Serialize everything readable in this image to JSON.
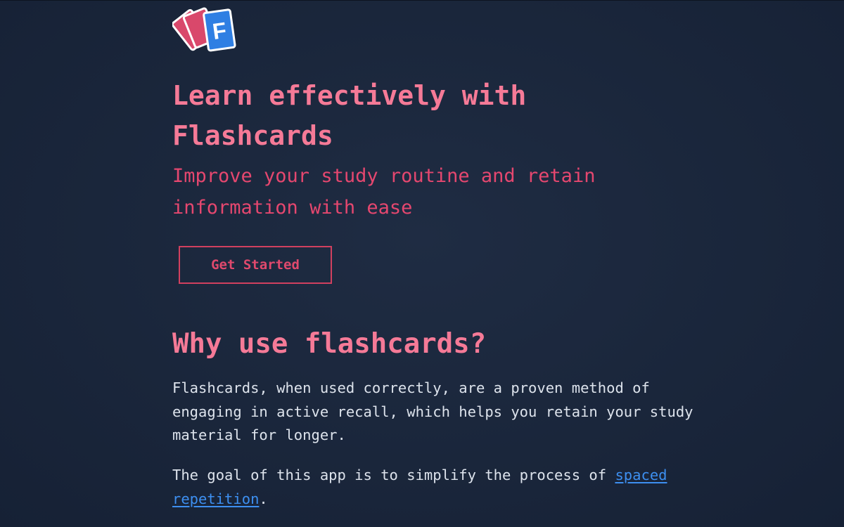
{
  "logo": {
    "icon": "flashcards-logo-icon",
    "letter": "F",
    "colors": {
      "back_card": "#d9486b",
      "front_card": "#2f7fe3",
      "card_border": "#ffffff"
    }
  },
  "hero": {
    "title": "Learn effectively with Flashcards",
    "subtitle": "Improve your study routine and retain information with ease",
    "cta_label": "Get Started"
  },
  "why": {
    "heading": "Why use flashcards?",
    "paragraph1": "Flashcards, when used correctly, are a proven method of engaging in active recall, which helps you retain your study material for longer.",
    "paragraph2_prefix": "The goal of this app is to simplify the process of ",
    "paragraph2_link": "spaced repetition",
    "paragraph2_suffix": "."
  },
  "colors": {
    "background": "#1b273c",
    "heading": "#f57a97",
    "accent": "#e5476f",
    "body_text": "#dde3ec",
    "link": "#3d8ff0"
  }
}
